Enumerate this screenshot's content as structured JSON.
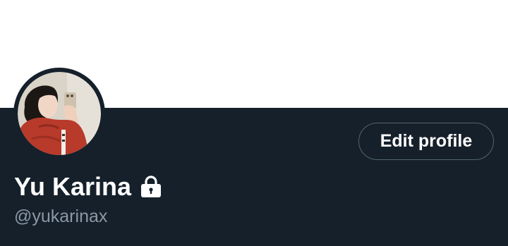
{
  "banner": {
    "color": "#ffffff"
  },
  "profile": {
    "display_name": "Yu Karina",
    "handle": "@yukarinax",
    "protected_icon": "lock-icon",
    "avatar_icon": "profile-photo"
  },
  "actions": {
    "edit_profile_label": "Edit profile"
  },
  "colors": {
    "background": "#15202b",
    "text_primary": "#ffffff",
    "text_secondary": "#8b98a5",
    "button_border": "#536471"
  }
}
